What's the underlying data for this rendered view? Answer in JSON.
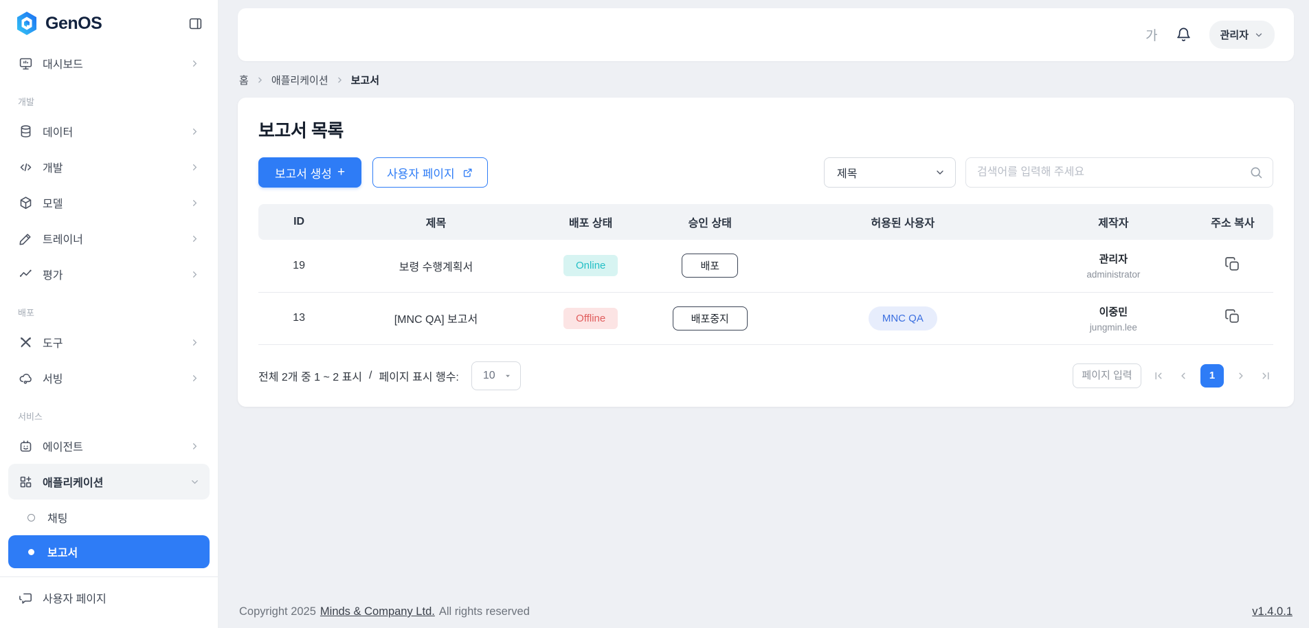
{
  "colors": {
    "primary": "#2e7cf6",
    "online_bg": "#d7f4f2",
    "online_text": "#23bfc6",
    "offline_bg": "#fce4e4",
    "offline_text": "#e05c5c",
    "allowed_user_badge_bg": "#e7edfc",
    "allowed_user_badge_text": "#3b6fe0"
  },
  "sidebar": {
    "logo": "GenOS",
    "items": {
      "dashboard": "대시보드",
      "section_dev": "개발",
      "data": "데이터",
      "develop": "개발",
      "model": "모델",
      "trainer": "트레이너",
      "evaluation": "평가",
      "section_deploy": "배포",
      "tools": "도구",
      "serving": "서빙",
      "section_service": "서비스",
      "agent": "에이전트",
      "application": "애플리케이션",
      "chat": "채팅",
      "report": "보고서",
      "user_page": "사용자 페이지"
    }
  },
  "header": {
    "font_toggle": "가",
    "user_menu": "관리자"
  },
  "breadcrumb": {
    "home": "홈",
    "application": "애플리케이션",
    "report": "보고서"
  },
  "main": {
    "title": "보고서 목록",
    "create_button": "보고서 생성",
    "create_button_plus": "+",
    "user_page_button": "사용자 페이지",
    "filter": {
      "selected": "제목"
    },
    "search": {
      "placeholder": "검색어를 입력해 주세요"
    },
    "table": {
      "headers": [
        "ID",
        "제목",
        "배포 상태",
        "승인 상태",
        "허용된 사용자",
        "제작자",
        "주소 복사"
      ],
      "rows": [
        {
          "id": "19",
          "title": "보령 수행계획서",
          "deploy_status": "Online",
          "approval": "배포",
          "allowed_users": "",
          "creator_name": "관리자",
          "creator_id": "administrator"
        },
        {
          "id": "13",
          "title": "[MNC QA] 보고서",
          "deploy_status": "Offline",
          "approval": "배포중지",
          "allowed_users": "MNC QA",
          "creator_name": "이중민",
          "creator_id": "jungmin.lee"
        }
      ]
    },
    "pagination": {
      "summary": "전체 2개 중 1 ~ 2 표시",
      "separator": "/",
      "rows_label": "페이지 표시 행수:",
      "rows_per_page": "10",
      "page_input_placeholder": "페이지 입력",
      "current_page": "1"
    }
  },
  "footer": {
    "copyright_prefix": "Copyright 2025",
    "company": "Minds & Company Ltd.",
    "copyright_suffix": "All rights reserved",
    "version": "v1.4.0.1"
  }
}
